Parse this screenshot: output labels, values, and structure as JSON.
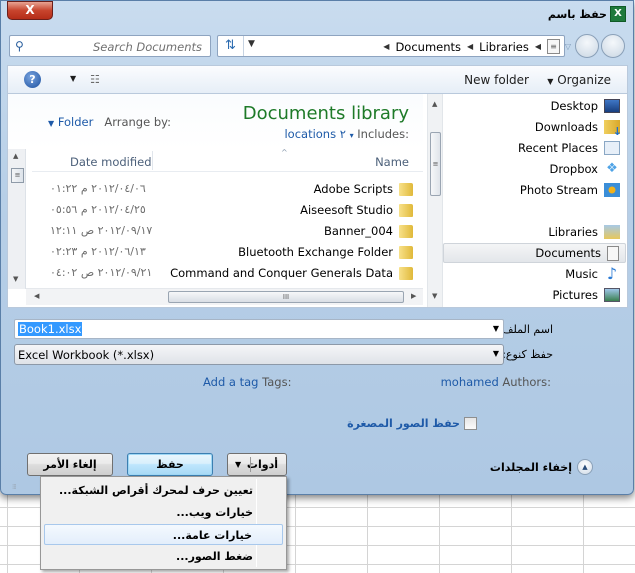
{
  "window": {
    "title": "حفظ باسم",
    "app_icon": "excel-icon",
    "close_label": "X"
  },
  "navigation": {
    "search_placeholder": "Search Documents",
    "breadcrumbs": [
      "Libraries",
      "Documents"
    ],
    "breadcrumb_icon": "documents-library-icon"
  },
  "toolbar": {
    "organize_label": "Organize",
    "new_folder_label": "New folder",
    "help_icon": "help-icon",
    "view_icon": "view-options-icon"
  },
  "library": {
    "title": "Documents library",
    "includes_label": "Includes:",
    "includes_value": "2 locations",
    "arrange_label": "Arrange by:",
    "arrange_value": "Folder"
  },
  "file_list": {
    "columns": [
      "Name",
      "Date modified"
    ],
    "rows": [
      {
        "name": "Adobe Scripts",
        "date": "٢٠١٢/٠٤/٠٦ م ٠١:٢٢"
      },
      {
        "name": "Aiseesoft Studio",
        "date": "٢٠١٢/٠٤/٢٥ م ٠٥:٥٦"
      },
      {
        "name": "Banner_004",
        "date": "٢٠١٢/٠٩/١٧ ص ١٢:١١"
      },
      {
        "name": "Bluetooth Exchange Folder",
        "date": "٢٠١٢/٠٦/١٣ م ٠٢:٢٣"
      },
      {
        "name": "Command and Conquer Generals Data",
        "date": "٢٠١٢/٠٩/٢١ ص ٠٤:٠٢"
      }
    ]
  },
  "nav_pane": {
    "favorites": [
      {
        "label": "Desktop",
        "icon": "desktop-icon"
      },
      {
        "label": "Downloads",
        "icon": "downloads-icon"
      },
      {
        "label": "Recent Places",
        "icon": "recent-places-icon"
      },
      {
        "label": "Dropbox",
        "icon": "dropbox-icon"
      },
      {
        "label": "Photo Stream",
        "icon": "photo-stream-icon"
      }
    ],
    "libraries": [
      {
        "label": "Libraries",
        "icon": "libraries-icon"
      },
      {
        "label": "Documents",
        "icon": "documents-icon",
        "selected": true
      },
      {
        "label": "Music",
        "icon": "music-icon"
      },
      {
        "label": "Pictures",
        "icon": "pictures-icon"
      }
    ]
  },
  "form": {
    "filename_label": "اسم الملف:",
    "filename_value": "Book1.xlsx",
    "filetype_label": "حفظ كنوع:",
    "filetype_value": "Excel Workbook (*.xlsx)",
    "authors_label": "Authors:",
    "authors_value": "mohamed",
    "tags_label": "Tags:",
    "tags_value": "Add a tag",
    "thumbnail_label": "حفظ الصور المصغرة",
    "thumbnail_checked": false
  },
  "footer": {
    "hide_folders_label": "إخفاء المجلدات",
    "tools_label": "أدوات",
    "save_label": "حفظ",
    "cancel_label": "إلغاء الأمر"
  },
  "tools_menu": {
    "items": [
      {
        "label": "تعيين حرف لمحرك أقراص الشبكة...",
        "highlighted": false
      },
      {
        "label": "خيارات ويب...",
        "highlighted": false
      },
      {
        "label": "خيارات عامة...",
        "highlighted": true
      },
      {
        "label": "ضغط الصور...",
        "highlighted": false
      }
    ]
  },
  "colors": {
    "library_title": "#1e7a28",
    "link": "#1e5aa8",
    "selection": "#3399ff"
  }
}
